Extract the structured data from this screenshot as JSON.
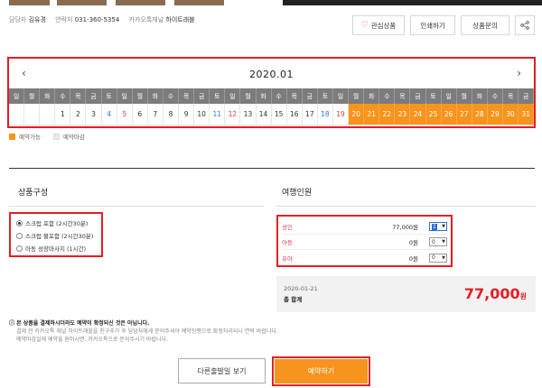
{
  "header": {
    "manager_label": "담당자",
    "manager_name": "김유경",
    "contact_label": "연락처",
    "contact_value": "031-360-5354",
    "kakao_label": "카카오톡채널",
    "kakao_value": "하이트래블",
    "wishlist_label": "관심상품",
    "print_label": "인쇄하기",
    "inquiry_label": "상품문의"
  },
  "calendar": {
    "title": "2020.01",
    "prev": "‹",
    "next": "›",
    "dow": [
      "일",
      "월",
      "화",
      "수",
      "목",
      "금",
      "토",
      "일",
      "월",
      "화",
      "수",
      "목",
      "금",
      "토",
      "일",
      "월",
      "화",
      "수",
      "목",
      "금",
      "토",
      "일",
      "월",
      "화",
      "수",
      "목",
      "금",
      "토",
      "일",
      "월",
      "화",
      "수",
      "목",
      "금"
    ],
    "dates": [
      "",
      "",
      "",
      "1",
      "2",
      "3",
      "4",
      "5",
      "6",
      "7",
      "8",
      "9",
      "10",
      "11",
      "12",
      "13",
      "14",
      "15",
      "16",
      "17",
      "18",
      "19",
      "20",
      "21",
      "22",
      "23",
      "24",
      "25",
      "26",
      "27",
      "28",
      "29",
      "30",
      "31"
    ],
    "first_available": 20
  },
  "legend": {
    "available": "예약가능",
    "closed": "예약마감",
    "available_color": "#f7941d",
    "closed_color": "#e9e9e9"
  },
  "options": {
    "title": "상품구성",
    "items": [
      "스크럽 포함 (2시간30분)",
      "스크럽 불포함 (2시간30분)",
      "아동 성장마사지 (1시간)"
    ],
    "selected_index": 0
  },
  "travelers": {
    "title": "여행인원",
    "rows": [
      {
        "label": "성인",
        "price": "77,000원",
        "qty": "1"
      },
      {
        "label": "아동",
        "price": "0원",
        "qty": "0"
      },
      {
        "label": "유아",
        "price": "0원",
        "qty": "0"
      }
    ]
  },
  "total": {
    "date": "2020-01-21",
    "label": "총 합계",
    "amount": "77,000",
    "unit": "원"
  },
  "notice": {
    "heading": "본 상품을 결제하시더라도 예약이 확정되신 것은 아닙니다.",
    "line1": "결제 전 카카오톡 채널 하이트래블을 친구추가 후 담당자에게 문의주셔야 예약진행으로 확정처리되니 연락 바랍니다.",
    "line2": "예약마감일에 예약을 원하시면, 카카오톡으로 문의주시기 바랍니다."
  },
  "buttons": {
    "other_dates": "다른출발일 보기",
    "book": "예약하기"
  }
}
